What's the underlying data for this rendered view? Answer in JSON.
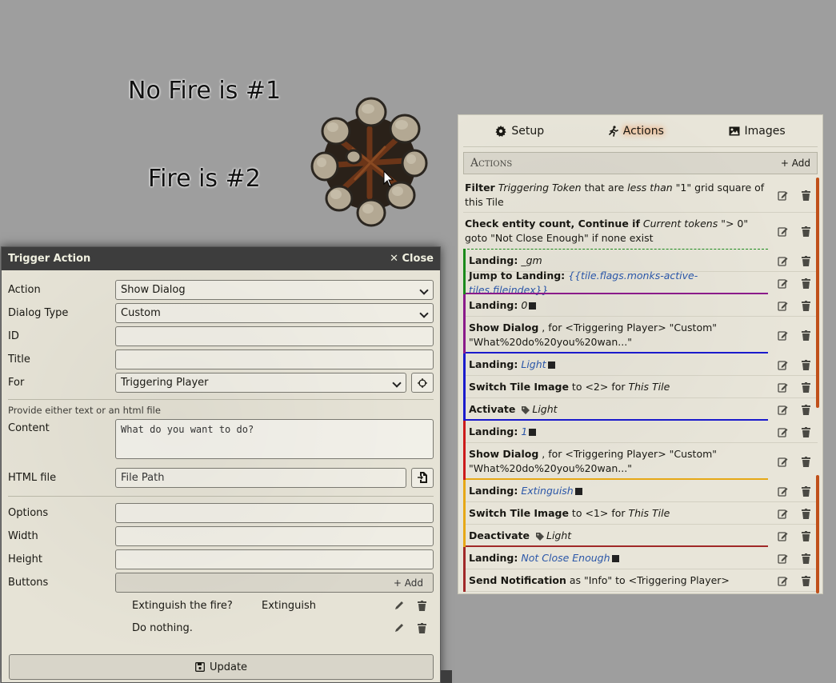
{
  "canvas": {
    "text1": "No Fire is #1",
    "text2": "Fire is #2"
  },
  "tile_config": {
    "tabs": [
      {
        "label": "Setup",
        "icon": "gear-icon"
      },
      {
        "label": "Actions",
        "icon": "running-icon",
        "active": true
      },
      {
        "label": "Images",
        "icon": "image-icon"
      }
    ],
    "header": "Actions",
    "add_label": "+ Add",
    "actions": [
      {
        "bold": "Filter",
        "rest_html": [
          {
            "i": "Triggering Token"
          },
          {
            "t": " that are "
          },
          {
            "i": "less than"
          },
          {
            "t": " \"1\" grid square of this Tile"
          }
        ]
      },
      {
        "bold": "Check entity count, Continue if",
        "rest_html": [
          {
            "i": "Current tokens"
          },
          {
            "t": " \"> 0\" goto \"Not Close Enough\" if none exist"
          }
        ]
      },
      {
        "bold": "Landing:",
        "rest_html": [
          {
            "i": "_gm"
          }
        ]
      },
      {
        "bold": "Jump to Landing:",
        "rest_html": [
          {
            "l": "{{tile.flags.monks-active-tiles.fileindex}}"
          }
        ]
      },
      {
        "bold": "Landing:",
        "rest_html": [
          {
            "i": "0"
          },
          {
            "sq": true
          }
        ]
      },
      {
        "bold": "Show Dialog",
        "rest_html": [
          {
            "t": ", for <Triggering Player> \"Custom\" \"What%20do%20you%20wan...\""
          }
        ]
      },
      {
        "bold": "Landing:",
        "rest_html": [
          {
            "l": "Light"
          },
          {
            "sq": true
          }
        ]
      },
      {
        "bold": "Switch Tile Image",
        "rest_html": [
          {
            "t": " to <2> for "
          },
          {
            "i": "This Tile"
          }
        ]
      },
      {
        "bold": "Activate",
        "rest_html": [
          {
            "tag": true
          },
          {
            "i": "Light"
          }
        ]
      },
      {
        "bold": "Landing:",
        "rest_html": [
          {
            "l": "1"
          },
          {
            "sq": true
          }
        ]
      },
      {
        "bold": "Show Dialog",
        "rest_html": [
          {
            "t": ", for <Triggering Player> \"Custom\" \"What%20do%20you%20wan...\""
          }
        ]
      },
      {
        "bold": "Landing:",
        "rest_html": [
          {
            "l": "Extinguish"
          },
          {
            "sq": true
          }
        ]
      },
      {
        "bold": "Switch Tile Image",
        "rest_html": [
          {
            "t": " to <1> for "
          },
          {
            "i": "This Tile"
          }
        ]
      },
      {
        "bold": "Deactivate",
        "rest_html": [
          {
            "tag": true
          },
          {
            "i": "Light"
          }
        ]
      },
      {
        "bold": "Landing:",
        "rest_html": [
          {
            "l": "Not Close Enough"
          },
          {
            "sq": true
          }
        ]
      },
      {
        "bold": "Send Notification",
        "rest_html": [
          {
            "t": " as \"Info\" to <Triggering Player>"
          }
        ]
      }
    ],
    "colors": {
      "green": "#1a8a1a",
      "purple": "#8a1a8a",
      "blue": "#1a1acc",
      "red": "#cc1a1a",
      "orange": "#e6a817",
      "darkred": "#a02828",
      "scroll": "#c0501a"
    }
  },
  "dialog": {
    "title": "Trigger Action",
    "close": "Close",
    "action_label": "Action",
    "action_value": "Show Dialog",
    "dialog_type_label": "Dialog Type",
    "dialog_type_value": "Custom",
    "id_label": "ID",
    "title_label": "Title",
    "for_label": "For",
    "for_value": "Triggering Player",
    "hint": "Provide either text or an html file",
    "content_label": "Content",
    "content_value": "What do you want to do?",
    "html_file_label": "HTML file",
    "html_file_placeholder": "File Path",
    "options_label": "Options",
    "width_label": "Width",
    "height_label": "Height",
    "buttons_label": "Buttons",
    "buttons_add": "+ Add",
    "buttons": [
      {
        "label": "Extinguish the fire?",
        "value": "Extinguish"
      },
      {
        "label": "Do nothing.",
        "value": ""
      }
    ],
    "update_label": "Update"
  }
}
